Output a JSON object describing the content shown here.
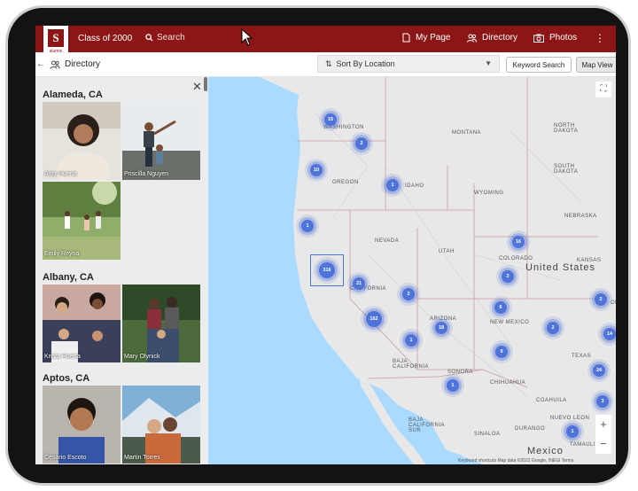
{
  "header": {
    "class_name": "Class of 2000",
    "logo_letter": "S",
    "logo_text": "alumni",
    "search_placeholder": "Search",
    "nav": [
      {
        "label": "My Page",
        "icon": "document-icon"
      },
      {
        "label": "Directory",
        "icon": "people-icon"
      },
      {
        "label": "Photos",
        "icon": "camera-icon"
      }
    ],
    "menu_icon": "more-vertical-icon"
  },
  "subheader": {
    "back_label": "Directory",
    "sort_label": "Sort By Location",
    "keyword_button": "Keyword Search",
    "map_button": "Map View"
  },
  "directory": {
    "groups": [
      {
        "city": "Alameda, CA",
        "people": [
          "Amy Huerta",
          "Priscilla Nguyen",
          "Emily Reyna"
        ]
      },
      {
        "city": "Albany, CA",
        "people": [
          "Krista Huerta",
          "Mary Olynick"
        ]
      },
      {
        "city": "Aptos, CA",
        "people": [
          "Cesario Escoto",
          "Martin Torres"
        ]
      }
    ]
  },
  "map": {
    "regions": [
      "WASHINGTON",
      "MONTANA",
      "NORTH DAKOTA",
      "SOUTH DAKOTA",
      "OREGON",
      "IDAHO",
      "WYOMING",
      "NEBRASKA",
      "NEVADA",
      "UTAH",
      "COLORADO",
      "KANSAS",
      "CALIFORNIA",
      "ARIZONA",
      "NEW MEXICO",
      "OK",
      "TEXAS",
      "BAJA CALIFORNIA",
      "SONORA",
      "CHIHUAHUA",
      "COAHUILA",
      "NUEVO LEON",
      "BAJA CALIFORNIA SUR",
      "SINALOA",
      "DURANGO",
      "TAMAULIPAS"
    ],
    "country_us": "United States",
    "country_mx": "Mexico",
    "clusters": [
      "15",
      "2",
      "10",
      "1",
      "1",
      "16",
      "316",
      "21",
      "2",
      "2",
      "162",
      "6",
      "18",
      "1",
      "9",
      "2",
      "2",
      "14",
      "24",
      "3",
      "1",
      "1"
    ],
    "zoom_in": "+",
    "zoom_out": "−",
    "expand_icon": "fullscreen-icon",
    "attribution": "Keyboard shortcuts   Map data ©2022 Google, INEGI   Terms"
  }
}
